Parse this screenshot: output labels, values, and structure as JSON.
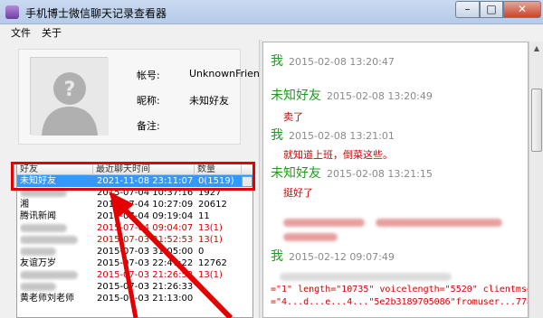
{
  "window": {
    "title": "手机博士微信聊天记录查看器"
  },
  "menu": {
    "items": [
      "文件",
      "关于"
    ]
  },
  "profile": {
    "account_label": "帐号:",
    "account_value": "UnknownFriend",
    "nickname_label": "昵称:",
    "nickname_value": "未知好友",
    "note_label": "备注:",
    "note_value": ""
  },
  "contacts": {
    "headers": [
      "好友",
      "最近聊天时间",
      "数量"
    ],
    "rows": [
      {
        "name": "未知好友",
        "time": "2021-11-08 23:11:07",
        "count": "0(1519)",
        "selected": true,
        "red": false,
        "name_hidden": false
      },
      {
        "name": "",
        "time": "2015-07-04 10:37:16",
        "count": "1927",
        "selected": false,
        "red": false,
        "name_hidden": true
      },
      {
        "name": "湘",
        "time": "2015-07-04 10:27:09",
        "count": "20612",
        "selected": false,
        "red": false,
        "name_hidden": false
      },
      {
        "name": "腾讯新闻",
        "time": "2015-07-04 09:19:04",
        "count": "11",
        "selected": false,
        "red": false,
        "name_hidden": false
      },
      {
        "name": "",
        "time": "2015-07-04 09:04:07",
        "count": "13(1)",
        "selected": false,
        "red": true,
        "name_hidden": true
      },
      {
        "name": "",
        "time": "2015-07-03 31:52:53",
        "count": "13(1)",
        "selected": false,
        "red": true,
        "name_hidden": true
      },
      {
        "name": "",
        "time": "2015-07-03 31:05:00",
        "count": "0",
        "selected": false,
        "red": false,
        "name_hidden": true
      },
      {
        "name": "友谊万岁",
        "time": "2015-07-03 22:47:22",
        "count": "12762",
        "selected": false,
        "red": false,
        "name_hidden": false
      },
      {
        "name": "",
        "time": "2015-07-03 21:26:52",
        "count": "13(1)",
        "selected": false,
        "red": true,
        "name_hidden": true
      },
      {
        "name": "",
        "time": "2015-07-03 21:26:33",
        "count": "",
        "selected": false,
        "red": false,
        "name_hidden": true
      },
      {
        "name": "黄老师刘老师",
        "time": "2015-07-03 21:13:00",
        "count": "",
        "selected": false,
        "red": false,
        "name_hidden": false
      }
    ]
  },
  "chat": {
    "messages": [
      {
        "sender": "我",
        "time": "2015-02-08 13:20:47",
        "body": ""
      },
      {
        "sender": "未知好友",
        "time": "2015-02-08 13:20:49",
        "body": "卖了"
      },
      {
        "sender": "我",
        "time": "2015-02-08 13:21:01",
        "body": "就知道上班，倒菜这些。"
      },
      {
        "sender": "未知好友",
        "time": "2015-02-08 13:21:15",
        "body": "挺好了"
      },
      {
        "sender": "我",
        "time": "2015-02-12 09:07:49",
        "body": ""
      }
    ],
    "code_lines": [
      "=\"1\" length=\"10735\" voicelength=\"5520\" clientmsgid",
      "=\"4...d...e...4...\"5e2b3189705086\"fromuser...7785"
    ]
  }
}
